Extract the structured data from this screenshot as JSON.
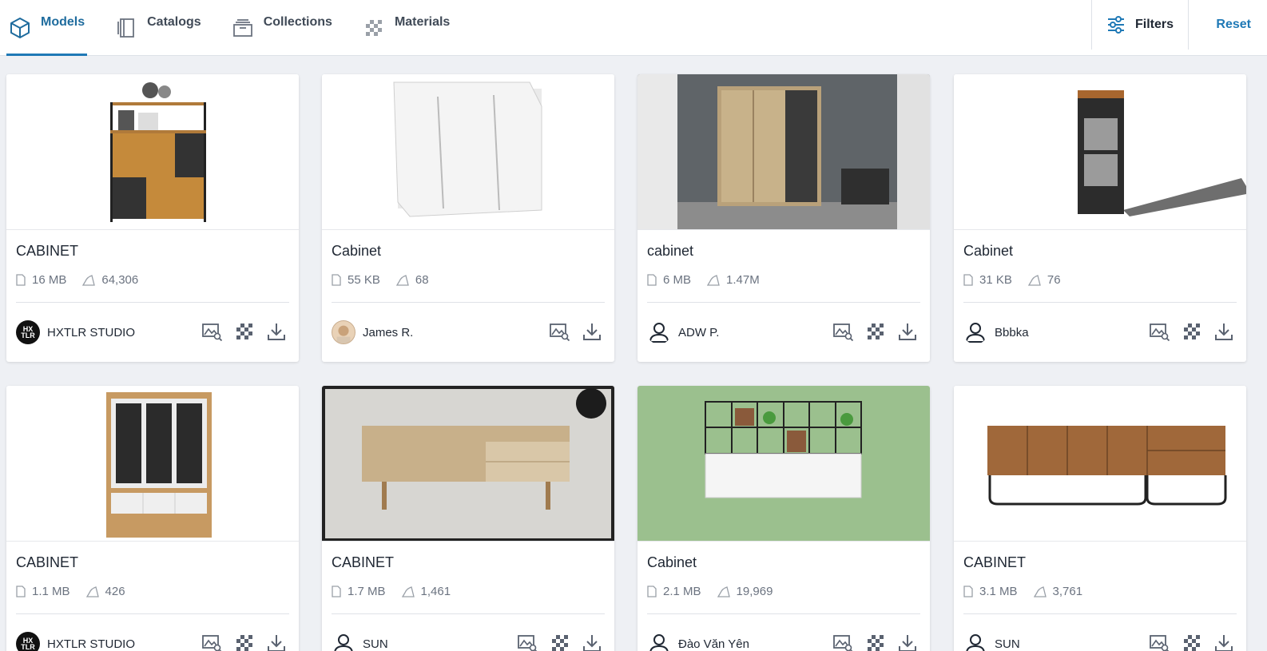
{
  "tabs": [
    {
      "label": "Models",
      "icon": "cube-icon",
      "active": true
    },
    {
      "label": "Catalogs",
      "icon": "catalog-icon",
      "active": false
    },
    {
      "label": "Collections",
      "icon": "collections-icon",
      "active": false
    },
    {
      "label": "Materials",
      "icon": "checker-icon",
      "active": false
    }
  ],
  "toolbar": {
    "filters_label": "Filters",
    "reset_label": "Reset"
  },
  "colors": {
    "accent": "#1f79b6",
    "background": "#eef0f4"
  },
  "cards": [
    {
      "title": "CABINET",
      "size": "16 MB",
      "downloads": "64,306",
      "author": "HXTLR STUDIO",
      "avatar": "logo",
      "has_materials": true
    },
    {
      "title": "Cabinet",
      "size": "55 KB",
      "downloads": "68",
      "author": "James R.",
      "avatar": "photo",
      "has_materials": false
    },
    {
      "title": "cabinet",
      "size": "6 MB",
      "downloads": "1.47M",
      "author": "ADW P.",
      "avatar": "user-icon",
      "has_materials": true
    },
    {
      "title": "Cabinet",
      "size": "31 KB",
      "downloads": "76",
      "author": "Bbbka",
      "avatar": "user-icon",
      "has_materials": true
    },
    {
      "title": "CABINET",
      "size": "1.1 MB",
      "downloads": "426",
      "author": "HXTLR STUDIO",
      "avatar": "logo",
      "has_materials": true
    },
    {
      "title": "CABINET",
      "size": "1.7 MB",
      "downloads": "1,461",
      "author": "SUN",
      "avatar": "user-icon",
      "has_materials": true
    },
    {
      "title": "Cabinet",
      "size": "2.1 MB",
      "downloads": "19,969",
      "author": "Đào Văn Yên",
      "avatar": "user-icon",
      "has_materials": true
    },
    {
      "title": "CABINET",
      "size": "3.1 MB",
      "downloads": "3,761",
      "author": "SUN",
      "avatar": "user-icon",
      "has_materials": true
    }
  ]
}
